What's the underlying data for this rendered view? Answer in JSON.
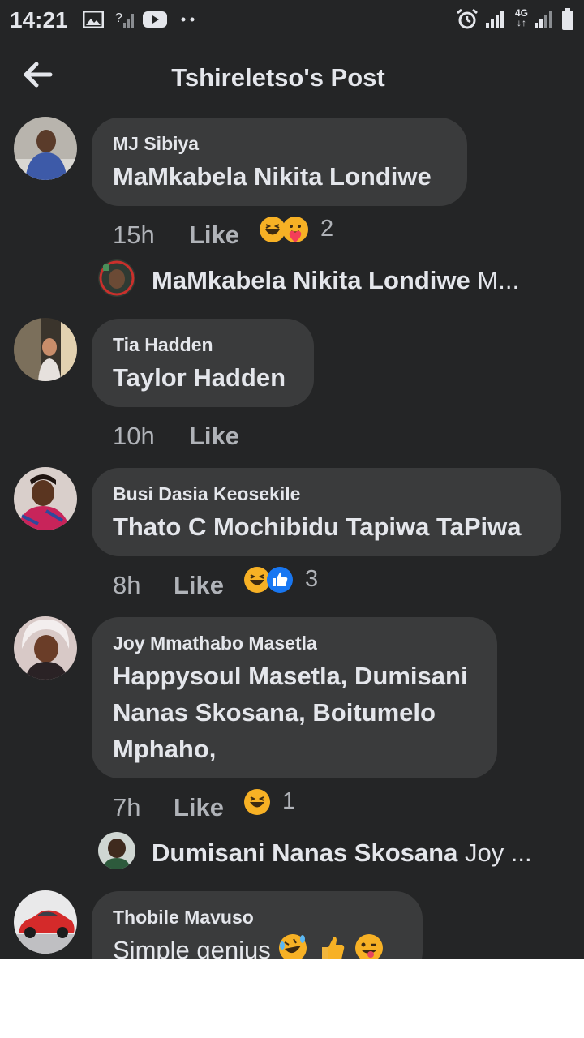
{
  "status_bar": {
    "time": "14:21",
    "icons": [
      "image-icon",
      "no-signal-icon",
      "youtube-icon",
      "more-dots-icon",
      "alarm-icon",
      "signal-icon",
      "4g-icon",
      "signal-icon",
      "battery-icon"
    ],
    "network_label": "4G"
  },
  "header": {
    "title": "Tshireletso's Post",
    "back_icon": "arrow-left-icon"
  },
  "colors": {
    "background": "#242526",
    "bubble": "#3a3b3c",
    "text_primary": "#e4e6eb",
    "text_secondary": "#b0b3b8",
    "like_blue": "#1877f2",
    "haha_yellow": "#f7b125"
  },
  "comments": [
    {
      "name": "MJ Sibiya",
      "text": "MaMkabela Nikita Londiwe",
      "time": "15h",
      "like_label": "Like",
      "reactions": [
        "haha-icon",
        "care-icon"
      ],
      "reaction_count": "2",
      "reply": {
        "name": "MaMkabela Nikita Londiwe",
        "snippet": "M..."
      }
    },
    {
      "name": "Tia Hadden",
      "text": "Taylor Hadden",
      "time": "10h",
      "like_label": "Like"
    },
    {
      "name": "Busi Dasia Keosekile",
      "text": "Thato C Mochibidu Tapiwa TaPiwa",
      "time": "8h",
      "like_label": "Like",
      "reactions": [
        "haha-icon",
        "like-icon"
      ],
      "reaction_count": "3"
    },
    {
      "name": "Joy Mmathabo Masetla",
      "text_lines": [
        "Happysoul Masetla, Dumisani",
        "Nanas Skosana, Boitumelo",
        "Mphaho,"
      ],
      "time": "7h",
      "like_label": "Like",
      "reactions": [
        "haha-icon"
      ],
      "reaction_count": "1",
      "reply": {
        "name": "Dumisani Nanas Skosana",
        "snippet": "Joy ..."
      }
    },
    {
      "name": "Thobile Mavuso",
      "text": "Simple genius",
      "text_emojis": [
        "rofl-emoji",
        "thumbs-up-emoji",
        "wink-tongue-emoji"
      ]
    }
  ]
}
